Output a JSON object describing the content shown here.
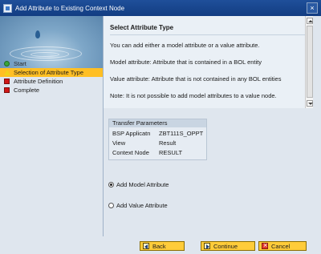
{
  "window": {
    "title": "Add Attribute to Existing Context Node",
    "close_glyph": "×"
  },
  "steps": [
    {
      "label": "Start",
      "status": "done"
    },
    {
      "label": "Selection of Attribute Type",
      "status": "current"
    },
    {
      "label": "Attribute Definition",
      "status": "pending"
    },
    {
      "label": "Complete",
      "status": "pending"
    }
  ],
  "info": {
    "heading": "Select Attribute Type",
    "lines": [
      "You can add either a model attribute or a value attribute.",
      "Model attribute: Attribute that is contained in a BOL entity",
      "Value attribute: Attribute that is not contained in any BOL entities",
      "Note: It is not possible to add model attributes to a value node."
    ]
  },
  "transfer": {
    "title": "Transfer Parameters",
    "rows": [
      {
        "label": "BSP Applicatn",
        "value": "ZBT111S_OPPT"
      },
      {
        "label": "View",
        "value": "Result"
      },
      {
        "label": "Context Node",
        "value": "RESULT"
      }
    ]
  },
  "options": {
    "model_label": "Add Model Attribute",
    "value_label": "Add Value Attribute",
    "selected": "model"
  },
  "buttons": {
    "back": "Back",
    "continue": "Continue",
    "cancel": "Cancel"
  },
  "colors": {
    "title_bar": "#1f4f9a",
    "active_step": "#ffbf24",
    "button": "#ffcc3a",
    "panel": "#dfe6ee"
  },
  "icons": {
    "done": "green-circle-icon",
    "current": "warning-triangle-icon",
    "pending": "red-square-icon"
  }
}
